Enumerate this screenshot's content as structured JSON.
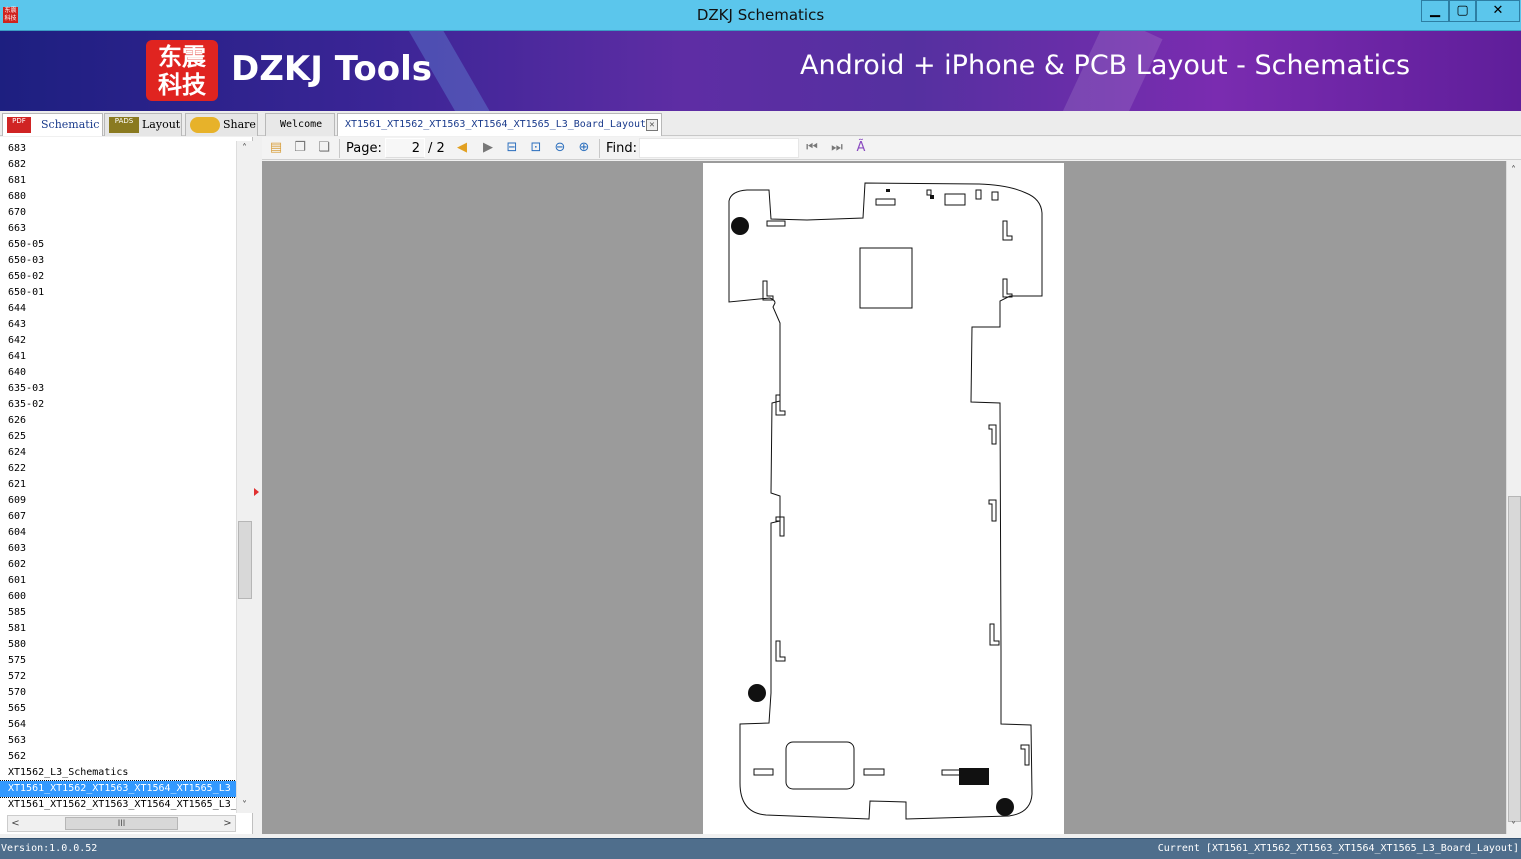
{
  "window": {
    "title": "DZKJ Schematics",
    "app_icon_text": "东震\n科技",
    "buttons": {
      "minimize": "▁",
      "maximize": "▢",
      "close": "✕"
    }
  },
  "banner": {
    "logo_text": "东震\n科技",
    "brand": "DZKJ Tools",
    "tagline": "Android + iPhone & PCB Layout - Schematics"
  },
  "left_tabs": [
    {
      "label": "Schematic",
      "icon": "pdf-icon",
      "icon_text": "PDF"
    },
    {
      "label": "Layout",
      "icon": "pads-icon",
      "icon_text": "PADS"
    },
    {
      "label": "Share",
      "icon": "cloud-share-icon",
      "icon_text": ""
    }
  ],
  "doc_tabs": [
    {
      "label": "Welcome"
    },
    {
      "label": "XT1561_XT1562_XT1563_XT1564_XT1565_L3_Board_Layout",
      "close": "✕"
    }
  ],
  "doc_list": {
    "items": [
      "683",
      "682",
      "681",
      "680",
      "670",
      "663",
      "650-05",
      "650-03",
      "650-02",
      "650-01",
      "644",
      "643",
      "642",
      "641",
      "640",
      "635-03",
      "635-02",
      "626",
      "625",
      "624",
      "622",
      "621",
      "609",
      "607",
      "604",
      "603",
      "602",
      "601",
      "600",
      "585",
      "581",
      "580",
      "575",
      "572",
      "570",
      "565",
      "564",
      "563",
      "562",
      "XT1562_L3_Schematics",
      "XT1561_XT1562_XT1563_XT1564_XT1565_L3",
      "XT1561_XT1562_XT1563_XT1564_XT1565_L3_"
    ],
    "selected_index": 40
  },
  "toolbar": {
    "page_label": "Page:",
    "page_value": "2",
    "page_total": "/ 2",
    "find_label": "Find:",
    "find_value": ""
  },
  "status": {
    "version": "Version:1.0.0.52",
    "current": "Current [XT1561_XT1562_XT1563_XT1564_XT1565_L3_Board_Layout]"
  },
  "colors": {
    "titlebar": "#5bc6ec",
    "selection": "#3399ff",
    "viewer_bg": "#9b9b9b",
    "statusbar": "#4f6e8c"
  }
}
